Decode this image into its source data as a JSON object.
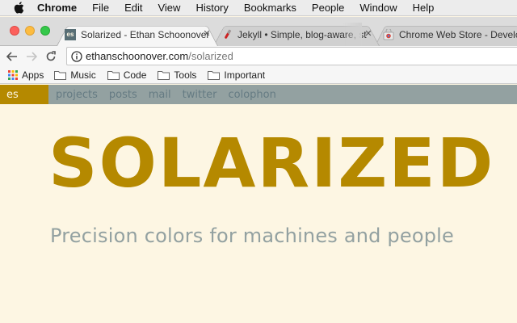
{
  "menubar": {
    "app_name": "Chrome",
    "items": [
      "File",
      "Edit",
      "View",
      "History",
      "Bookmarks",
      "People",
      "Window",
      "Help"
    ]
  },
  "tabs": [
    {
      "title": "Solarized - Ethan Schoonover",
      "favicon": "es-favicon",
      "active": true
    },
    {
      "title": "Jekyll • Simple, blog-aware, st",
      "favicon": "test-tube-icon",
      "active": false
    },
    {
      "title": "Chrome Web Store - Developer",
      "favicon": "chrome-web-store-icon",
      "active": false
    }
  ],
  "omnibox": {
    "host": "ethanschoonover.com",
    "path": "/solarized"
  },
  "bookmarks": [
    {
      "label": "Apps",
      "icon": "apps-grid-icon"
    },
    {
      "label": "Music",
      "icon": "folder-icon"
    },
    {
      "label": "Code",
      "icon": "folder-icon"
    },
    {
      "label": "Tools",
      "icon": "folder-icon"
    },
    {
      "label": "Important",
      "icon": "folder-icon"
    }
  ],
  "site": {
    "brand": "es",
    "nav": [
      "projects",
      "posts",
      "mail",
      "twitter",
      "colophon"
    ],
    "title": "SOLARIZED",
    "subtitle": "Precision colors for machines and people"
  },
  "colors": {
    "base3": "#fdf6e3",
    "base1": "#93a1a1",
    "base00": "#657b83",
    "yellow": "#b58900"
  }
}
